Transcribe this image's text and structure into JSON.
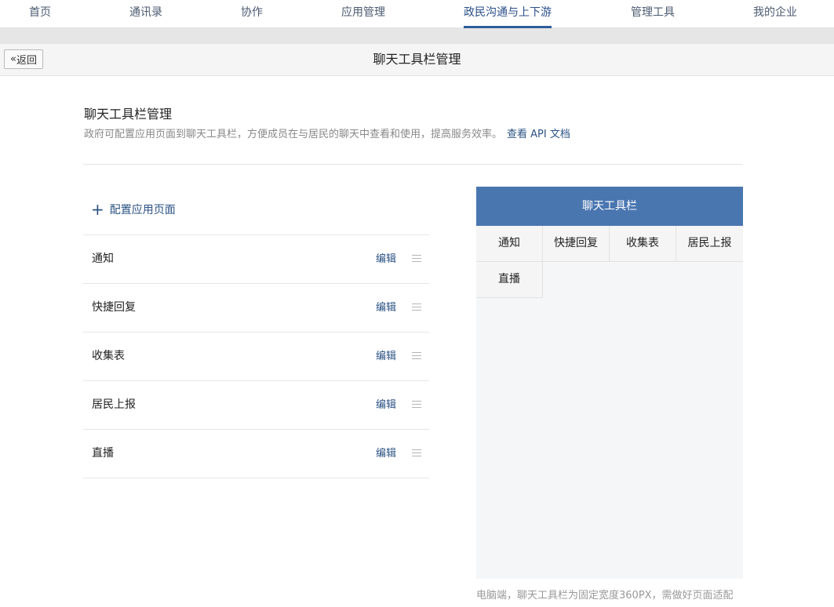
{
  "nav": {
    "tabs": [
      {
        "label": "首页"
      },
      {
        "label": "通讯录"
      },
      {
        "label": "协作"
      },
      {
        "label": "应用管理"
      },
      {
        "label": "政民沟通与上下游",
        "active": true
      },
      {
        "label": "管理工具"
      },
      {
        "label": "我的企业"
      }
    ]
  },
  "header": {
    "back_label": "返回",
    "title": "聊天工具栏管理"
  },
  "section": {
    "title": "聊天工具栏管理",
    "description": "政府可配置应用页面到聊天工具栏，方便成员在与居民的聊天中查看和使用，提高服务效率。",
    "api_link": "查看 API 文档"
  },
  "list": {
    "add_label": "配置应用页面",
    "edit_label": "编辑",
    "items": [
      {
        "name": "通知"
      },
      {
        "name": "快捷回复"
      },
      {
        "name": "收集表"
      },
      {
        "name": "居民上报"
      },
      {
        "name": "直播"
      }
    ]
  },
  "preview": {
    "title": "聊天工具栏",
    "items": [
      "通知",
      "快捷回复",
      "收集表",
      "居民上报",
      "直播"
    ],
    "note": "电脑端，聊天工具栏为固定宽度360PX，需做好页面适配"
  },
  "colors": {
    "accent": "#2e5d9a",
    "link": "#2b5283",
    "preview_header": "#4a76b0"
  }
}
